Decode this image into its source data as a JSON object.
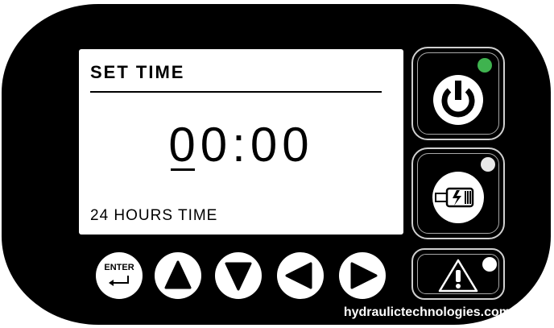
{
  "display": {
    "title": "SET TIME",
    "clock": "00:00",
    "mode": "24 HOURS TIME"
  },
  "buttons": {
    "enter_label": "ENTER",
    "nav_icons": [
      "enter-icon",
      "up-arrow-icon",
      "down-arrow-icon",
      "left-arrow-icon",
      "right-arrow-icon"
    ],
    "side": [
      {
        "name": "power-button",
        "icon": "power-icon",
        "led_color": "#3fb34f"
      },
      {
        "name": "output-button",
        "icon": "pump-output-icon",
        "led_color": "#e8e8e8"
      },
      {
        "name": "alarm-button",
        "icon": "warning-icon",
        "led_color": "#ffffff"
      }
    ]
  },
  "colors": {
    "panel": "#000000",
    "screen": "#ffffff",
    "power_led": "#3fb34f"
  },
  "footer": {
    "brand": "hydraulictechnologies.com"
  }
}
